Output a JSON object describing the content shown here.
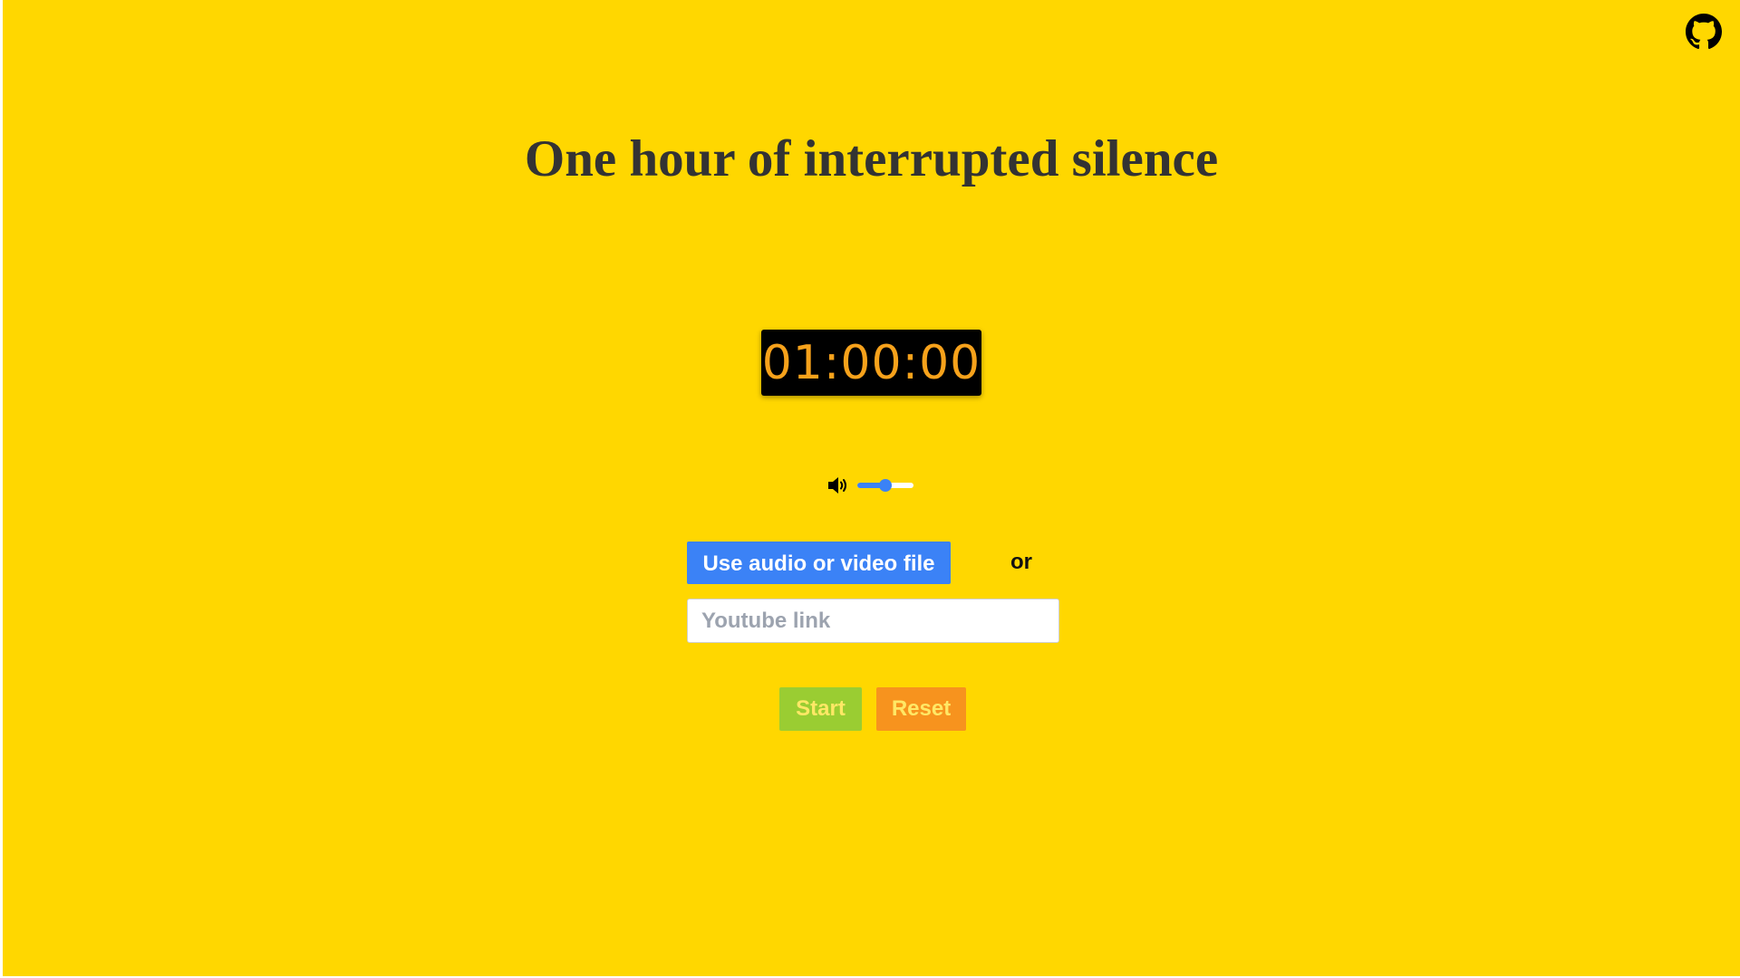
{
  "page": {
    "title": "One hour of interrupted silence"
  },
  "header": {
    "github_icon": "github-icon"
  },
  "timer": {
    "display": "01:00:00"
  },
  "volume": {
    "icon": "speaker-volume-icon",
    "level": 0.5
  },
  "controls": {
    "file_button_label": "Use audio or video file",
    "or_label": "or",
    "youtube_placeholder": "Youtube link",
    "youtube_value": "",
    "start_label": "Start",
    "reset_label": "Reset"
  },
  "colors": {
    "background": "#FFD700",
    "timer_text": "#F7A21B",
    "file_button": "#3B82F6",
    "start_button": "#9ACD32",
    "reset_button": "#F7931E"
  }
}
